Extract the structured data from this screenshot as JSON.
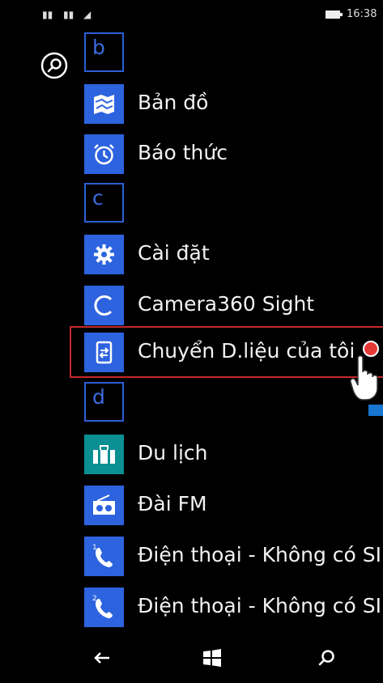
{
  "status_bar": {
    "time": "16:38"
  },
  "apps": [
    {
      "type": "header",
      "letter": "b"
    },
    {
      "type": "app",
      "label": "Bản đồ",
      "icon": "maps-icon"
    },
    {
      "type": "app",
      "label": "Báo thức",
      "icon": "alarm-clock-icon"
    },
    {
      "type": "header",
      "letter": "c"
    },
    {
      "type": "app",
      "label": "Cài đặt",
      "icon": "gear-icon"
    },
    {
      "type": "app",
      "label": "Camera360 Sight",
      "icon": "camera360-icon"
    },
    {
      "type": "app",
      "label": "Chuyển D.liệu của tôi",
      "icon": "transfer-data-icon",
      "highlighted": true
    },
    {
      "type": "header",
      "letter": "d"
    },
    {
      "type": "app",
      "label": "Du lịch",
      "icon": "suitcase-icon",
      "color": "#0a8f92"
    },
    {
      "type": "app",
      "label": "Đài FM",
      "icon": "radio-icon"
    },
    {
      "type": "app",
      "label": "Điện thoại - Không có SIM",
      "icon": "phone-1-icon"
    },
    {
      "type": "app",
      "label": "Điện thoại - Không có SIM",
      "icon": "phone-2-icon"
    }
  ],
  "colors": {
    "accent": "#2d63df",
    "highlight_border": "#c62828",
    "background": "#000000"
  },
  "navbar": [
    "back-icon",
    "windows-start-icon",
    "search-icon"
  ]
}
